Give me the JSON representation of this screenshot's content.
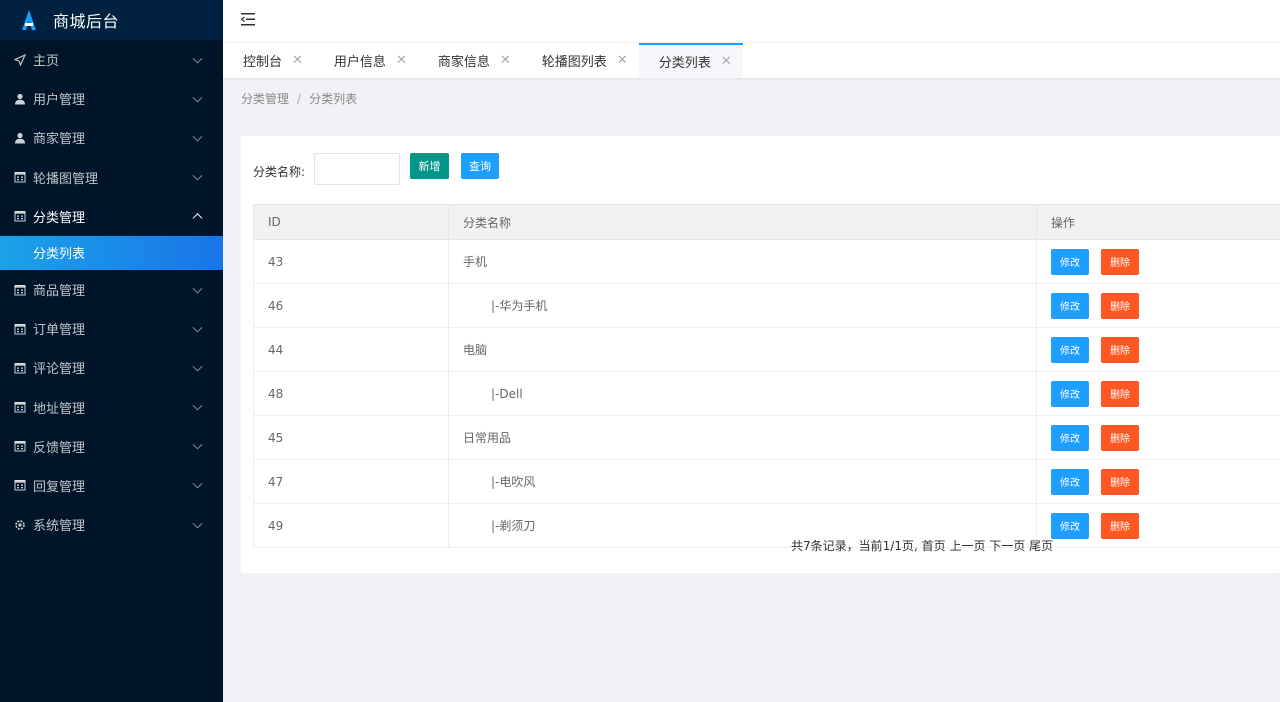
{
  "app": {
    "title": "商城后台"
  },
  "sidebar": {
    "items": [
      {
        "label": "主页",
        "icon": "paper-plane-icon"
      },
      {
        "label": "用户管理",
        "icon": "user-icon"
      },
      {
        "label": "商家管理",
        "icon": "user-icon"
      },
      {
        "label": "轮播图管理",
        "icon": "calendar-icon"
      },
      {
        "label": "分类管理",
        "icon": "calendar-icon",
        "open": true,
        "children": [
          {
            "label": "分类列表",
            "active": true
          }
        ]
      },
      {
        "label": "商品管理",
        "icon": "calendar-icon"
      },
      {
        "label": "订单管理",
        "icon": "calendar-icon"
      },
      {
        "label": "评论管理",
        "icon": "calendar-icon"
      },
      {
        "label": "地址管理",
        "icon": "calendar-icon"
      },
      {
        "label": "反馈管理",
        "icon": "calendar-icon"
      },
      {
        "label": "回复管理",
        "icon": "calendar-icon"
      },
      {
        "label": "系统管理",
        "icon": "gear-icon"
      }
    ]
  },
  "tabs": [
    {
      "label": "控制台"
    },
    {
      "label": "用户信息"
    },
    {
      "label": "商家信息"
    },
    {
      "label": "轮播图列表"
    },
    {
      "label": "分类列表",
      "active": true
    }
  ],
  "tab_close": "✕",
  "breadcrumb": {
    "parent": "分类管理",
    "separator": "/",
    "current": "分类列表"
  },
  "search": {
    "label": "分类名称:",
    "value": "",
    "add_label": "新增",
    "query_label": "查询"
  },
  "table": {
    "headers": [
      "ID",
      "分类名称",
      "操作"
    ],
    "rows": [
      {
        "id": "43",
        "name": "手机",
        "child": false
      },
      {
        "id": "46",
        "name": "|-华为手机",
        "child": true
      },
      {
        "id": "44",
        "name": "电脑",
        "child": false
      },
      {
        "id": "48",
        "name": "|-Dell",
        "child": true
      },
      {
        "id": "45",
        "name": "日常用品",
        "child": false
      },
      {
        "id": "47",
        "name": "|-电吹风",
        "child": true
      },
      {
        "id": "49",
        "name": "|-剃须刀",
        "child": true
      }
    ],
    "edit_label": "修改",
    "delete_label": "删除"
  },
  "pager": {
    "summary": "共7条记录，当前1/1页,",
    "first": "首页",
    "prev": "上一页",
    "next": "下一页",
    "last": "尾页"
  },
  "colors": {
    "sidebar": "#001529",
    "accent": "#1e9fff",
    "add": "#009688",
    "delete": "#ff5722"
  }
}
